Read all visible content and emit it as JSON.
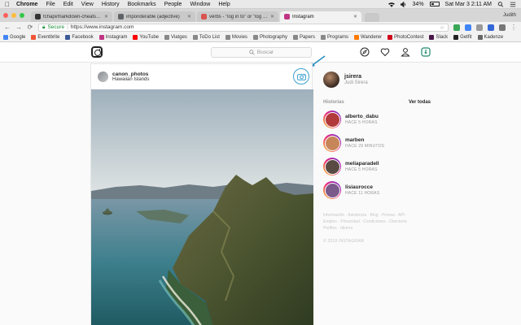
{
  "menubar": {
    "app": "Chrome",
    "items": [
      "File",
      "Edit",
      "View",
      "History",
      "Bookmarks",
      "People",
      "Window",
      "Help"
    ],
    "battery": "34%",
    "clock": "Sat Mar 3  2:11 AM",
    "user": "Judith Sirera Pulido"
  },
  "tabs": [
    {
      "label": "fchapi/markdown-cheatsheet",
      "color": "#333333"
    },
    {
      "label": "imponderable (adjective)",
      "color": "#5f6368"
    },
    {
      "label": "verbs - \"log in to\" or \"log into\"",
      "color": "#d9534f"
    },
    {
      "label": "Instagram",
      "color": "#c13584"
    }
  ],
  "profile_name": "Judith",
  "address": {
    "secure": "Secure",
    "url": "https://www.instagram.com"
  },
  "bookmarks": [
    {
      "label": "Google",
      "color": "#4285f4"
    },
    {
      "label": "Eventbrite",
      "color": "#f05537"
    },
    {
      "label": "Facebook",
      "color": "#3b5998"
    },
    {
      "label": "Instagram",
      "color": "#c13584"
    },
    {
      "label": "YouTube",
      "color": "#ff0000"
    },
    {
      "label": "Viatges",
      "color": "#888888"
    },
    {
      "label": "ToDo List",
      "color": "#888888"
    },
    {
      "label": "Movies",
      "color": "#888888"
    },
    {
      "label": "Photography",
      "color": "#888888"
    },
    {
      "label": "Papers",
      "color": "#888888"
    },
    {
      "label": "Programs",
      "color": "#888888"
    },
    {
      "label": "Wanderer",
      "color": "#ff7a00"
    },
    {
      "label": "PhotoContest",
      "color": "#d0021b"
    },
    {
      "label": "Slack",
      "color": "#4a154b"
    },
    {
      "label": "Getfit",
      "color": "#222222"
    },
    {
      "label": "Kadenze",
      "color": "#666666"
    }
  ],
  "instagram": {
    "search_placeholder": "Buscar",
    "post": {
      "username": "canon_photos",
      "location": "Hawaiian Islands"
    },
    "me": {
      "username": "jsirera",
      "full_name": "Judi Sirera"
    },
    "stories_title": "Historias",
    "stories_see_all": "Ver todas",
    "stories": [
      {
        "name": "alberto_dabu",
        "time": "HACE 5 HORAS",
        "color": "#b23a3a"
      },
      {
        "name": "marben",
        "time": "HACE 29 MINUTOS",
        "color": "#c7865a"
      },
      {
        "name": "meliaparadell",
        "time": "HACE 5 HORAS",
        "color": "#5a4a44"
      },
      {
        "name": "lisiaurocce",
        "time": "HACE 11 HORAS",
        "color": "#7a5a8a"
      }
    ],
    "footer_links": "Información · Asistencia · Blog · Prensa · API · Empleo · Privacidad · Condiciones · Directorio · Perfiles · Idioma",
    "copyright": "© 2018 INSTAGRAM"
  }
}
